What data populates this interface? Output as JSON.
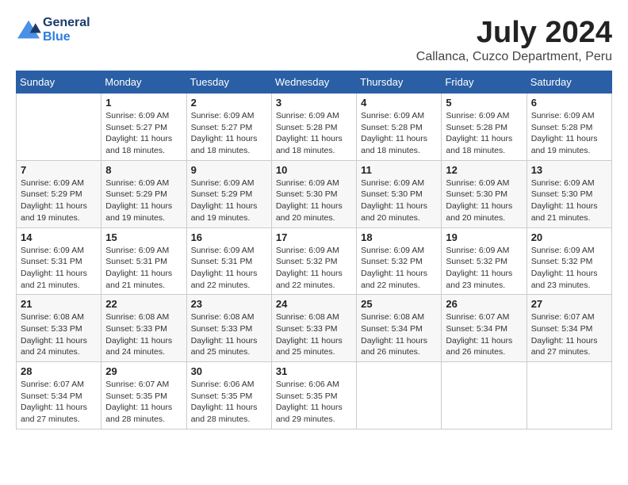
{
  "header": {
    "logo_line1": "General",
    "logo_line2": "Blue",
    "month": "July 2024",
    "location": "Callanca, Cuzco Department, Peru"
  },
  "days_of_week": [
    "Sunday",
    "Monday",
    "Tuesday",
    "Wednesday",
    "Thursday",
    "Friday",
    "Saturday"
  ],
  "weeks": [
    [
      {
        "day": "",
        "sunrise": "",
        "sunset": "",
        "daylight": ""
      },
      {
        "day": "1",
        "sunrise": "Sunrise: 6:09 AM",
        "sunset": "Sunset: 5:27 PM",
        "daylight": "Daylight: 11 hours and 18 minutes."
      },
      {
        "day": "2",
        "sunrise": "Sunrise: 6:09 AM",
        "sunset": "Sunset: 5:27 PM",
        "daylight": "Daylight: 11 hours and 18 minutes."
      },
      {
        "day": "3",
        "sunrise": "Sunrise: 6:09 AM",
        "sunset": "Sunset: 5:28 PM",
        "daylight": "Daylight: 11 hours and 18 minutes."
      },
      {
        "day": "4",
        "sunrise": "Sunrise: 6:09 AM",
        "sunset": "Sunset: 5:28 PM",
        "daylight": "Daylight: 11 hours and 18 minutes."
      },
      {
        "day": "5",
        "sunrise": "Sunrise: 6:09 AM",
        "sunset": "Sunset: 5:28 PM",
        "daylight": "Daylight: 11 hours and 18 minutes."
      },
      {
        "day": "6",
        "sunrise": "Sunrise: 6:09 AM",
        "sunset": "Sunset: 5:28 PM",
        "daylight": "Daylight: 11 hours and 19 minutes."
      }
    ],
    [
      {
        "day": "7",
        "sunrise": "Sunrise: 6:09 AM",
        "sunset": "Sunset: 5:29 PM",
        "daylight": "Daylight: 11 hours and 19 minutes."
      },
      {
        "day": "8",
        "sunrise": "Sunrise: 6:09 AM",
        "sunset": "Sunset: 5:29 PM",
        "daylight": "Daylight: 11 hours and 19 minutes."
      },
      {
        "day": "9",
        "sunrise": "Sunrise: 6:09 AM",
        "sunset": "Sunset: 5:29 PM",
        "daylight": "Daylight: 11 hours and 19 minutes."
      },
      {
        "day": "10",
        "sunrise": "Sunrise: 6:09 AM",
        "sunset": "Sunset: 5:30 PM",
        "daylight": "Daylight: 11 hours and 20 minutes."
      },
      {
        "day": "11",
        "sunrise": "Sunrise: 6:09 AM",
        "sunset": "Sunset: 5:30 PM",
        "daylight": "Daylight: 11 hours and 20 minutes."
      },
      {
        "day": "12",
        "sunrise": "Sunrise: 6:09 AM",
        "sunset": "Sunset: 5:30 PM",
        "daylight": "Daylight: 11 hours and 20 minutes."
      },
      {
        "day": "13",
        "sunrise": "Sunrise: 6:09 AM",
        "sunset": "Sunset: 5:30 PM",
        "daylight": "Daylight: 11 hours and 21 minutes."
      }
    ],
    [
      {
        "day": "14",
        "sunrise": "Sunrise: 6:09 AM",
        "sunset": "Sunset: 5:31 PM",
        "daylight": "Daylight: 11 hours and 21 minutes."
      },
      {
        "day": "15",
        "sunrise": "Sunrise: 6:09 AM",
        "sunset": "Sunset: 5:31 PM",
        "daylight": "Daylight: 11 hours and 21 minutes."
      },
      {
        "day": "16",
        "sunrise": "Sunrise: 6:09 AM",
        "sunset": "Sunset: 5:31 PM",
        "daylight": "Daylight: 11 hours and 22 minutes."
      },
      {
        "day": "17",
        "sunrise": "Sunrise: 6:09 AM",
        "sunset": "Sunset: 5:32 PM",
        "daylight": "Daylight: 11 hours and 22 minutes."
      },
      {
        "day": "18",
        "sunrise": "Sunrise: 6:09 AM",
        "sunset": "Sunset: 5:32 PM",
        "daylight": "Daylight: 11 hours and 22 minutes."
      },
      {
        "day": "19",
        "sunrise": "Sunrise: 6:09 AM",
        "sunset": "Sunset: 5:32 PM",
        "daylight": "Daylight: 11 hours and 23 minutes."
      },
      {
        "day": "20",
        "sunrise": "Sunrise: 6:09 AM",
        "sunset": "Sunset: 5:32 PM",
        "daylight": "Daylight: 11 hours and 23 minutes."
      }
    ],
    [
      {
        "day": "21",
        "sunrise": "Sunrise: 6:08 AM",
        "sunset": "Sunset: 5:33 PM",
        "daylight": "Daylight: 11 hours and 24 minutes."
      },
      {
        "day": "22",
        "sunrise": "Sunrise: 6:08 AM",
        "sunset": "Sunset: 5:33 PM",
        "daylight": "Daylight: 11 hours and 24 minutes."
      },
      {
        "day": "23",
        "sunrise": "Sunrise: 6:08 AM",
        "sunset": "Sunset: 5:33 PM",
        "daylight": "Daylight: 11 hours and 25 minutes."
      },
      {
        "day": "24",
        "sunrise": "Sunrise: 6:08 AM",
        "sunset": "Sunset: 5:33 PM",
        "daylight": "Daylight: 11 hours and 25 minutes."
      },
      {
        "day": "25",
        "sunrise": "Sunrise: 6:08 AM",
        "sunset": "Sunset: 5:34 PM",
        "daylight": "Daylight: 11 hours and 26 minutes."
      },
      {
        "day": "26",
        "sunrise": "Sunrise: 6:07 AM",
        "sunset": "Sunset: 5:34 PM",
        "daylight": "Daylight: 11 hours and 26 minutes."
      },
      {
        "day": "27",
        "sunrise": "Sunrise: 6:07 AM",
        "sunset": "Sunset: 5:34 PM",
        "daylight": "Daylight: 11 hours and 27 minutes."
      }
    ],
    [
      {
        "day": "28",
        "sunrise": "Sunrise: 6:07 AM",
        "sunset": "Sunset: 5:34 PM",
        "daylight": "Daylight: 11 hours and 27 minutes."
      },
      {
        "day": "29",
        "sunrise": "Sunrise: 6:07 AM",
        "sunset": "Sunset: 5:35 PM",
        "daylight": "Daylight: 11 hours and 28 minutes."
      },
      {
        "day": "30",
        "sunrise": "Sunrise: 6:06 AM",
        "sunset": "Sunset: 5:35 PM",
        "daylight": "Daylight: 11 hours and 28 minutes."
      },
      {
        "day": "31",
        "sunrise": "Sunrise: 6:06 AM",
        "sunset": "Sunset: 5:35 PM",
        "daylight": "Daylight: 11 hours and 29 minutes."
      },
      {
        "day": "",
        "sunrise": "",
        "sunset": "",
        "daylight": ""
      },
      {
        "day": "",
        "sunrise": "",
        "sunset": "",
        "daylight": ""
      },
      {
        "day": "",
        "sunrise": "",
        "sunset": "",
        "daylight": ""
      }
    ]
  ]
}
